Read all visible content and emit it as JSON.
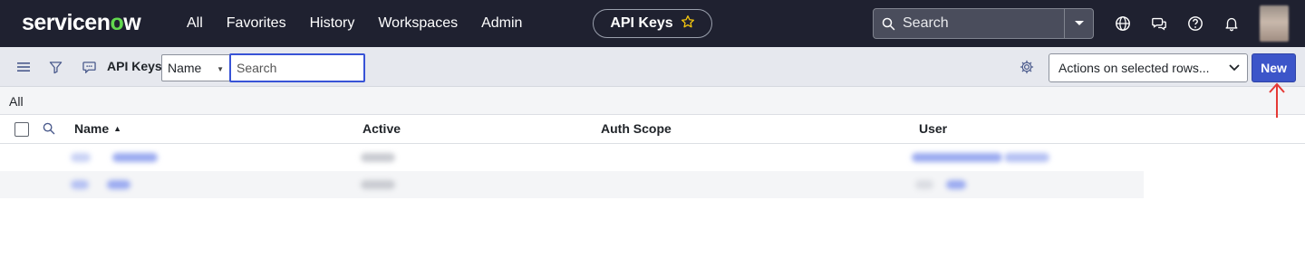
{
  "brand": {
    "logo_text": "servicenow",
    "logo_accent_color": "#62d84e"
  },
  "nav": {
    "items": [
      "All",
      "Favorites",
      "History",
      "Workspaces",
      "Admin"
    ],
    "context_title": "API Keys",
    "search_placeholder": "Search"
  },
  "icons": {
    "favorite": "star-icon",
    "global_search": "search-icon",
    "language": "globe-icon",
    "chat": "chat-icon",
    "help": "help-icon",
    "notifications": "bell-icon",
    "list_menu": "hamburger-icon",
    "filter": "filter-icon",
    "list_context": "comment-icon",
    "personalize": "gear-icon",
    "column_search": "search-icon"
  },
  "list": {
    "title": "API Keys",
    "search_field": "Name",
    "search_placeholder": "Search",
    "actions_placeholder": "Actions on selected rows...",
    "new_label": "New",
    "breadcrumb": "All"
  },
  "table": {
    "columns": [
      "Name",
      "Active",
      "Auth Scope",
      "User"
    ],
    "sort_column": "Name",
    "sort_direction": "ascending",
    "row_count_visible": 2
  },
  "colors": {
    "nav_bg": "#1f2130",
    "primary_button": "#3c55c9",
    "annotation_arrow": "#e53935"
  }
}
